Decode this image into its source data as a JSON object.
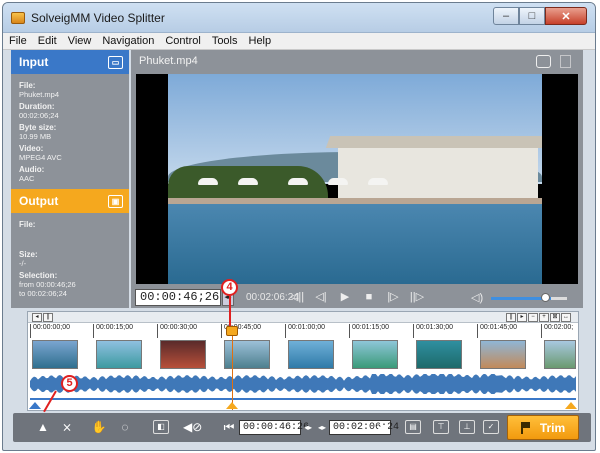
{
  "window": {
    "title": "SolveigMM Video Splitter",
    "buttons": {
      "minimize": "‒",
      "maximize": "□",
      "close": "✕"
    }
  },
  "menu": [
    "File",
    "Edit",
    "View",
    "Navigation",
    "Control",
    "Tools",
    "Help"
  ],
  "input_panel": {
    "title": "Input",
    "file_label": "File:",
    "file_value": "Phuket.mp4",
    "duration_label": "Duration:",
    "duration_value": "00:02:06;24",
    "bytesize_label": "Byte size:",
    "bytesize_value": "10.99 MB",
    "video_label": "Video:",
    "video_value": "MPEG4 AVC",
    "audio_label": "Audio:",
    "audio_value": "AAC"
  },
  "output_panel": {
    "title": "Output",
    "file_label": "File:",
    "size_label": "Size:",
    "size_value": "-/-",
    "selection_label": "Selection:",
    "selection_from": "from  00:00:46;26",
    "selection_to": "to      00:02:06;24"
  },
  "player": {
    "filename": "Phuket.mp4",
    "current_time": "00:00:46;26",
    "total_duration": "00:02:06:24"
  },
  "timeline": {
    "ruler_labels": [
      "00:00:00;00",
      "00:00:15;00",
      "00:00:30;00",
      "00:00:45;00",
      "00:01:00;00",
      "00:01:15;00",
      "00:01:30;00",
      "00:01:45;00",
      "00:02:00;"
    ],
    "position_fraction": 0.37
  },
  "callouts": {
    "cursor": "4",
    "marker": "5"
  },
  "bottom": {
    "start_time": "00:00:46:26",
    "end_time": "00:02:06:24",
    "trim_label": "Trim"
  },
  "colors": {
    "accent_blue": "#3a78c8",
    "accent_orange": "#f5a81e",
    "panel_gray": "#8d9299"
  }
}
